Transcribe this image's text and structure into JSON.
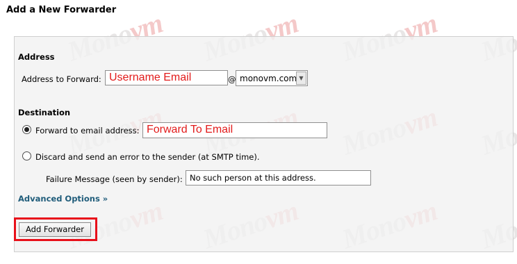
{
  "page": {
    "title": "Add a New Forwarder"
  },
  "address": {
    "section_title": "Address",
    "label": "Address to Forward:",
    "input_value": "Username Email",
    "at_sign": "@",
    "domain_selected": "monovm.com"
  },
  "destination": {
    "section_title": "Destination",
    "forward_option_label": "Forward to email address:",
    "forward_input_value": "Forward To Email",
    "discard_option_label": "Discard and send an error to the sender (at SMTP time).",
    "failure_label": "Failure Message (seen by sender):",
    "failure_value": "No such person at this address."
  },
  "advanced_link": "Advanced Options »",
  "submit_label": "Add Forwarder",
  "watermark": {
    "prefix": "Mono",
    "suffix": "vm"
  },
  "colors": {
    "highlight": "#e8101a",
    "annotation_text": "#e21b1b",
    "link": "#1f5c7a"
  },
  "icons": {
    "select_arrow": "chevron-down-icon",
    "radio_selected": "radio-selected-icon",
    "radio_unselected": "radio-unselected-icon"
  }
}
